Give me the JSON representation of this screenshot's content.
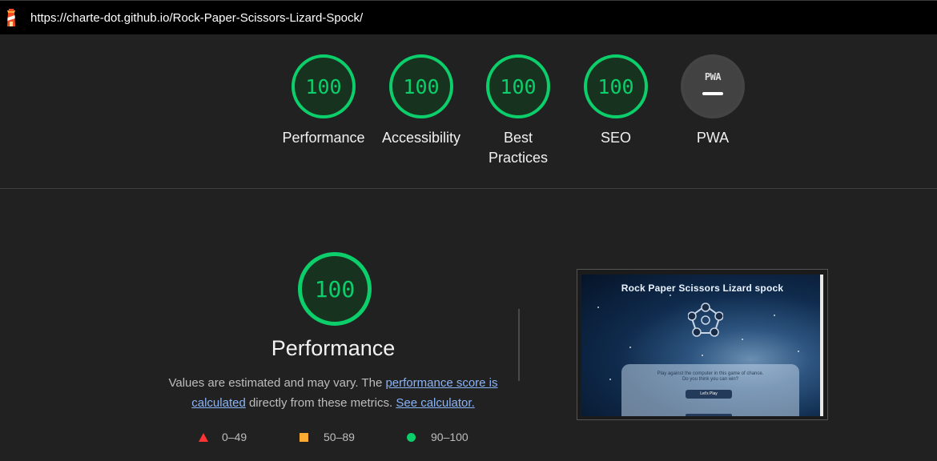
{
  "browser": {
    "url": "https://charte-dot.github.io/Rock-Paper-Scissors-Lizard-Spock/"
  },
  "scores": [
    {
      "value": "100",
      "label_line1": "Performance",
      "label_line2": ""
    },
    {
      "value": "100",
      "label_line1": "Accessibility",
      "label_line2": ""
    },
    {
      "value": "100",
      "label_line1": "Best",
      "label_line2": "Practices"
    },
    {
      "value": "100",
      "label_line1": "SEO",
      "label_line2": ""
    },
    {
      "value": "",
      "badge": "PWA",
      "label_line1": "PWA",
      "label_line2": ""
    }
  ],
  "performance": {
    "score": "100",
    "title": "Performance",
    "desc_prefix": "Values are estimated and may vary. The ",
    "desc_link1": "performance score is calculated",
    "desc_middle": " directly from these metrics. ",
    "desc_link2": "See calculator."
  },
  "legend": [
    {
      "range": "0–49",
      "color": "#ff3333",
      "shape": "triangle"
    },
    {
      "range": "50–89",
      "color": "#ffaa33",
      "shape": "square"
    },
    {
      "range": "90–100",
      "color": "#0cce6b",
      "shape": "circle"
    }
  ],
  "screenshot": {
    "title": "Rock Paper Scissors Lizard spock",
    "text_line1": "Play against the computer in this game of chance.",
    "text_line2": "Do you think you can win?",
    "button": "Let's Play"
  },
  "colors": {
    "pass": "#0cce6b",
    "average": "#ffaa33",
    "fail": "#ff3333",
    "link": "#8ab4f8"
  }
}
